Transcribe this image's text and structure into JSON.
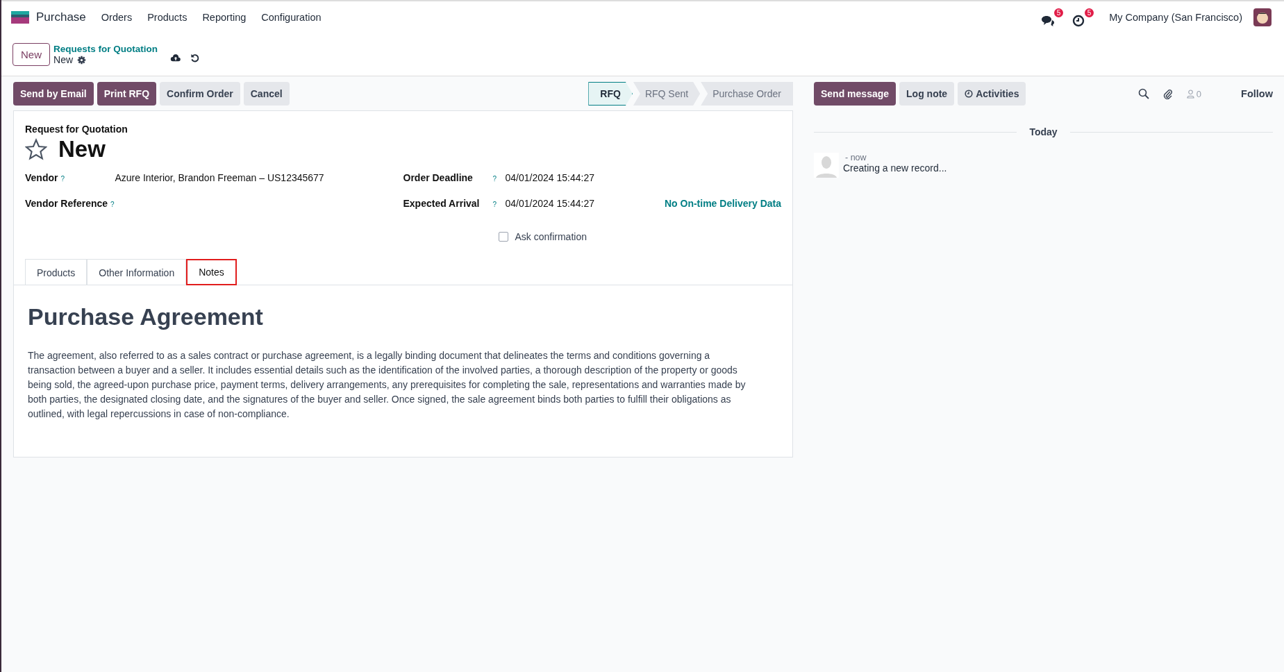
{
  "navbar": {
    "app": "Purchase",
    "menu": [
      "Orders",
      "Products",
      "Reporting",
      "Configuration"
    ],
    "messages_badge": "5",
    "activities_badge": "5",
    "company": "My Company (San Francisco)"
  },
  "control_panel": {
    "new_button": "New",
    "breadcrumb": "Requests for Quotation",
    "record": "New"
  },
  "actions": [
    {
      "label": "Send by Email",
      "kind": "primary"
    },
    {
      "label": "Print RFQ",
      "kind": "primary"
    },
    {
      "label": "Confirm Order",
      "kind": "secondary"
    },
    {
      "label": "Cancel",
      "kind": "secondary"
    }
  ],
  "stages": [
    {
      "label": "RFQ",
      "selected": true
    },
    {
      "label": "RFQ Sent",
      "selected": false
    },
    {
      "label": "Purchase Order",
      "selected": false
    }
  ],
  "form": {
    "subtitle": "Request for Quotation",
    "title": "New",
    "starred": false,
    "left_fields": [
      {
        "label": "Vendor",
        "help": "?",
        "value": "Azure Interior, Brandon Freeman – US12345677"
      },
      {
        "label": "Vendor Reference",
        "help": "?"
      }
    ],
    "right_fields": [
      {
        "label": "Order Deadline",
        "help": "?",
        "value": "04/01/2024 15:44:27"
      },
      {
        "label": "Expected Arrival",
        "help": "?",
        "value": "04/01/2024 15:44:27",
        "extra": "No On-time Delivery Data"
      }
    ],
    "ask_confirmation": {
      "label": "Ask confirmation",
      "checked": false
    },
    "tabs": [
      {
        "label": "Products",
        "selected": false,
        "highlighted": false
      },
      {
        "label": "Other Information",
        "selected": false,
        "highlighted": false
      },
      {
        "label": "Notes",
        "selected": true,
        "highlighted": true
      }
    ],
    "notes": {
      "heading": "Purchase Agreement",
      "body": "The agreement, also referred to as a sales contract or purchase agreement, is a legally binding document that delineates the terms and conditions governing a transaction between a buyer and a seller. It includes essential details such as the identification of the involved parties, a thorough description of the property or goods being sold, the agreed-upon purchase price, payment terms, delivery arrangements, any prerequisites for completing the sale, representations and warranties made by both parties, the designated closing date, and the signatures of the buyer and seller. Once signed, the sale agreement binds both parties to fulfill their obligations as outlined, with legal repercussions in case of non-compliance."
    }
  },
  "chatter": {
    "send_message": "Send message",
    "log_note": "Log note",
    "activities": "Activities",
    "followers": "0",
    "follow": "Follow",
    "date_separator": "Today",
    "messages": [
      {
        "time": "- now",
        "text": "Creating a new record..."
      }
    ]
  }
}
